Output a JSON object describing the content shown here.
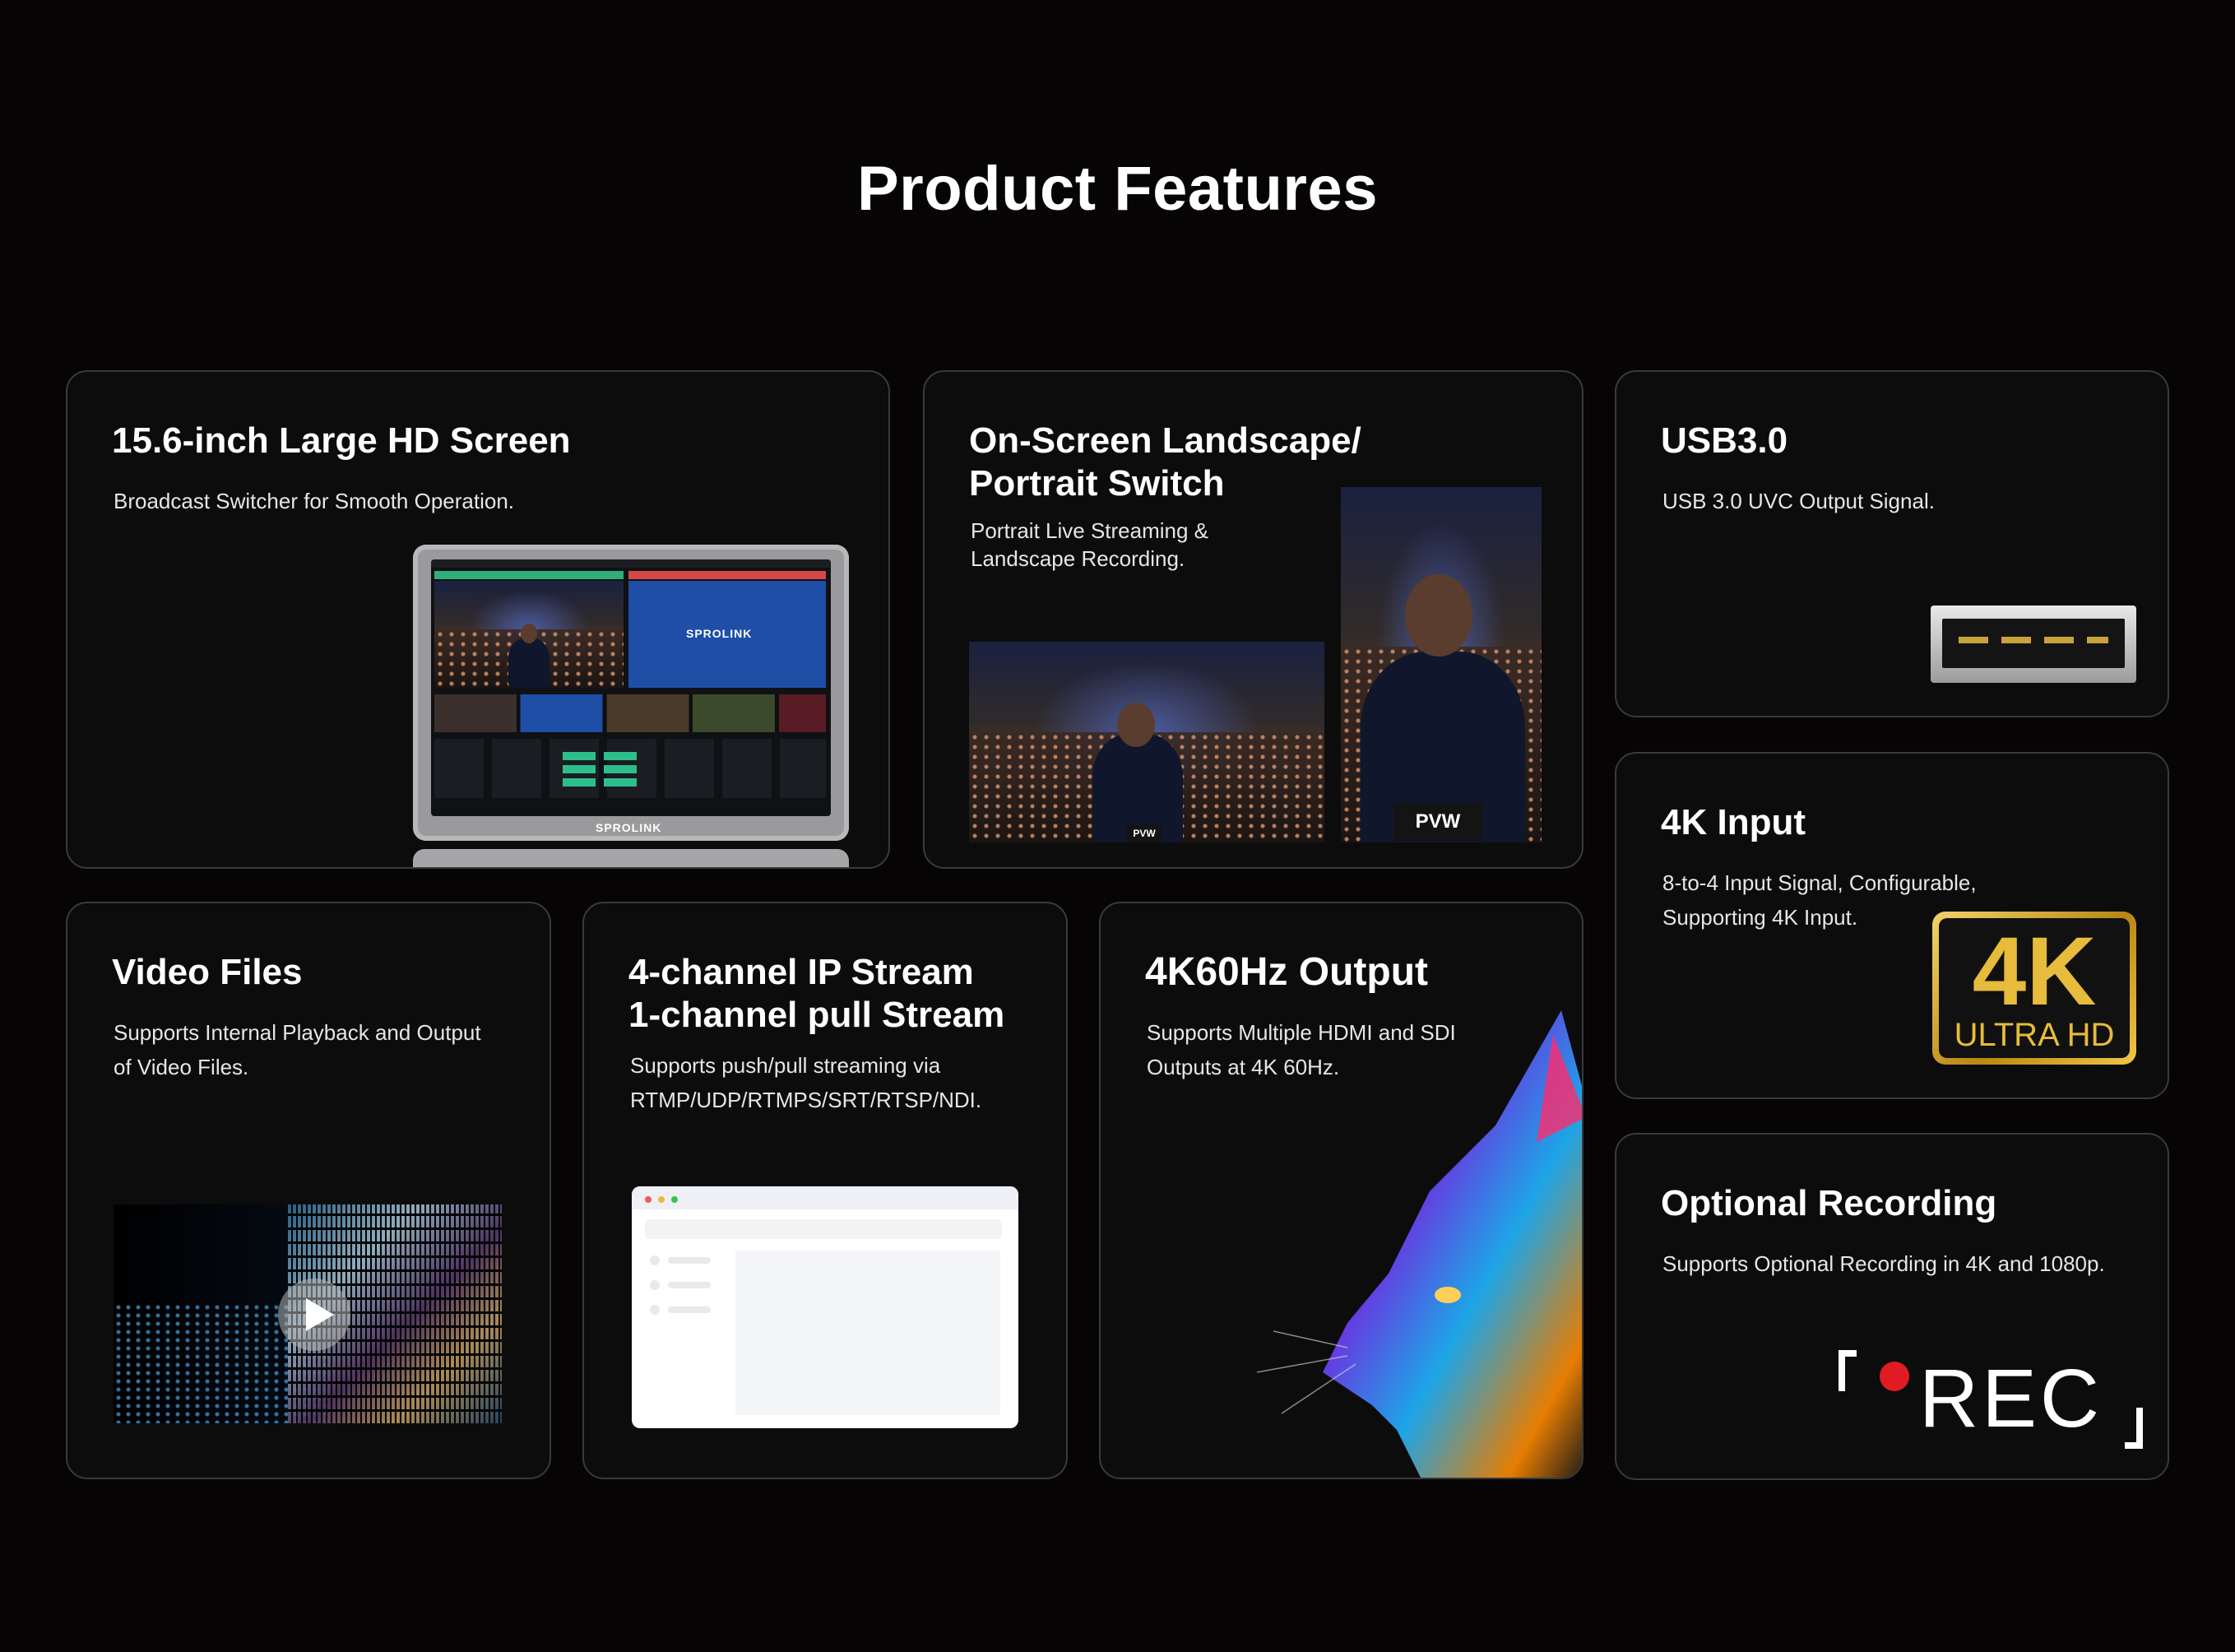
{
  "page": {
    "title": "Product Features"
  },
  "cards": {
    "screen": {
      "title": "15.6-inch Large HD Screen",
      "desc": "Broadcast Switcher for Smooth Operation.",
      "brand": "SPROLINK"
    },
    "orientation": {
      "title_line1": "On-Screen Landscape/",
      "title_line2": "Portrait Switch",
      "desc_line1": "Portrait Live Streaming &",
      "desc_line2": "Landscape Recording.",
      "tag_small": "PVW",
      "tag_large": "PVW"
    },
    "usb": {
      "title": "USB3.0",
      "desc": "USB 3.0 UVC Output Signal."
    },
    "input4k": {
      "title": "4K Input",
      "desc_line1": "8-to-4 Input Signal, Configurable,",
      "desc_line2": "Supporting 4K Input.",
      "badge_big": "4K",
      "badge_small": "ULTRA HD"
    },
    "video": {
      "title": "Video Files",
      "desc_line1": "Supports Internal Playback and Output",
      "desc_line2": "of Video Files."
    },
    "stream": {
      "title_line1": "4-channel IP Stream",
      "title_line2": "1-channel pull Stream",
      "desc_line1": "Supports push/pull streaming via",
      "desc_line2": "RTMP/UDP/RTMPS/SRT/RTSP/NDI."
    },
    "output": {
      "title": "4K60Hz Output",
      "desc_line1": "Supports Multiple HDMI and SDI",
      "desc_line2": "Outputs at 4K 60Hz."
    },
    "recording": {
      "title": "Optional Recording",
      "desc": "Supports Optional Recording in 4K and 1080p.",
      "rec_label": "REC"
    }
  },
  "colors": {
    "background": "#060404",
    "card_border": "#3a3a3c",
    "rec_dot": "#e11b22",
    "badge_gold": "#e7bb3b"
  },
  "icons": [
    "play-icon",
    "usb-port-icon",
    "record-icon",
    "4k-ultra-hd-badge"
  ]
}
